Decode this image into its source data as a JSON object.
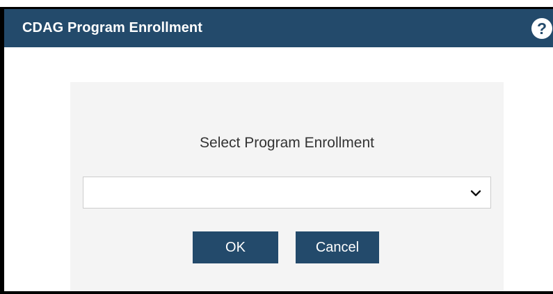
{
  "dialog": {
    "title": "CDAG Program Enrollment",
    "help_symbol": "?"
  },
  "form": {
    "prompt": "Select Program Enrollment",
    "select_value": "",
    "ok_label": "OK",
    "cancel_label": "Cancel"
  },
  "colors": {
    "header": "#234a6b",
    "panel": "#f4f4f4",
    "button": "#234a6b"
  }
}
